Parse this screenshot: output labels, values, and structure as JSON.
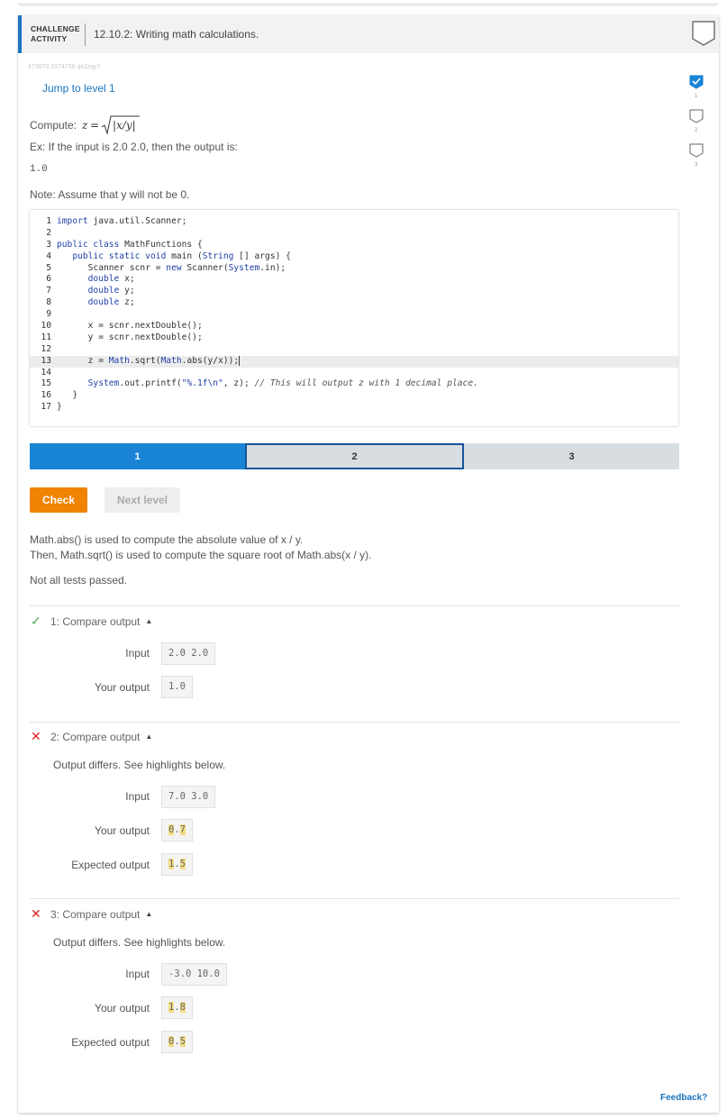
{
  "header": {
    "kind_line1": "CHALLENGE",
    "kind_line2": "ACTIVITY",
    "title": "12.10.2: Writing math calculations."
  },
  "activity_id": "473670.2874738.qx3zqy7",
  "jump_label": "Jump to level 1",
  "levels": [
    {
      "num": "1",
      "done": true
    },
    {
      "num": "2",
      "done": false
    },
    {
      "num": "3",
      "done": false
    }
  ],
  "prompt": {
    "compute_prefix": "Compute:",
    "example": "Ex: If the input is 2.0 2.0, then the output is:",
    "example_output": "1.0",
    "note": "Note: Assume that y will not be 0."
  },
  "code": {
    "lines": [
      {
        "n": "1",
        "text": "import java.util.Scanner;"
      },
      {
        "n": "2",
        "text": ""
      },
      {
        "n": "3",
        "text": "public class MathFunctions {"
      },
      {
        "n": "4",
        "text": "   public static void main (String [] args) {"
      },
      {
        "n": "5",
        "text": "      Scanner scnr = new Scanner(System.in);"
      },
      {
        "n": "6",
        "text": "      double x;"
      },
      {
        "n": "7",
        "text": "      double y;"
      },
      {
        "n": "8",
        "text": "      double z;"
      },
      {
        "n": "9",
        "text": ""
      },
      {
        "n": "10",
        "text": "      x = scnr.nextDouble();"
      },
      {
        "n": "11",
        "text": "      y = scnr.nextDouble();"
      },
      {
        "n": "12",
        "text": ""
      },
      {
        "n": "13",
        "text": "      z = Math.sqrt(Math.abs(y/x));"
      },
      {
        "n": "14",
        "text": ""
      },
      {
        "n": "15",
        "text": "      System.out.printf(\"%.1f\\n\", z); // This will output z with 1 decimal place."
      },
      {
        "n": "16",
        "text": "   }"
      },
      {
        "n": "17",
        "text": "}"
      }
    ],
    "active_line": 13
  },
  "progress": [
    "1",
    "2",
    "3"
  ],
  "buttons": {
    "check": "Check",
    "next": "Next level"
  },
  "explanation": {
    "line1": "Math.abs() is used to compute the absolute value of x / y.",
    "line2": "Then, Math.sqrt() is used to compute the square root of Math.abs(x / y).",
    "status": "Not all tests passed."
  },
  "tests": {
    "t1": {
      "title": "1: Compare output",
      "input_label": "Input",
      "input": "2.0 2.0",
      "your_label": "Your output",
      "your": "1.0"
    },
    "t2": {
      "title": "2: Compare output",
      "differs": "Output differs. See highlights below.",
      "input_label": "Input",
      "input": "7.0 3.0",
      "your_label": "Your output",
      "your_a": "0",
      "your_b": ".",
      "your_c": "7",
      "expected_label": "Expected output",
      "exp_a": "1",
      "exp_b": ".",
      "exp_c": "5"
    },
    "t3": {
      "title": "3: Compare output",
      "differs": "Output differs. See highlights below.",
      "input_label": "Input",
      "input": "-3.0 10.0",
      "your_label": "Your output",
      "your_a": "1",
      "your_b": ".",
      "your_c": "8",
      "expected_label": "Expected output",
      "exp_a": "0",
      "exp_b": ".",
      "exp_c": "5"
    }
  },
  "feedback": "Feedback?"
}
